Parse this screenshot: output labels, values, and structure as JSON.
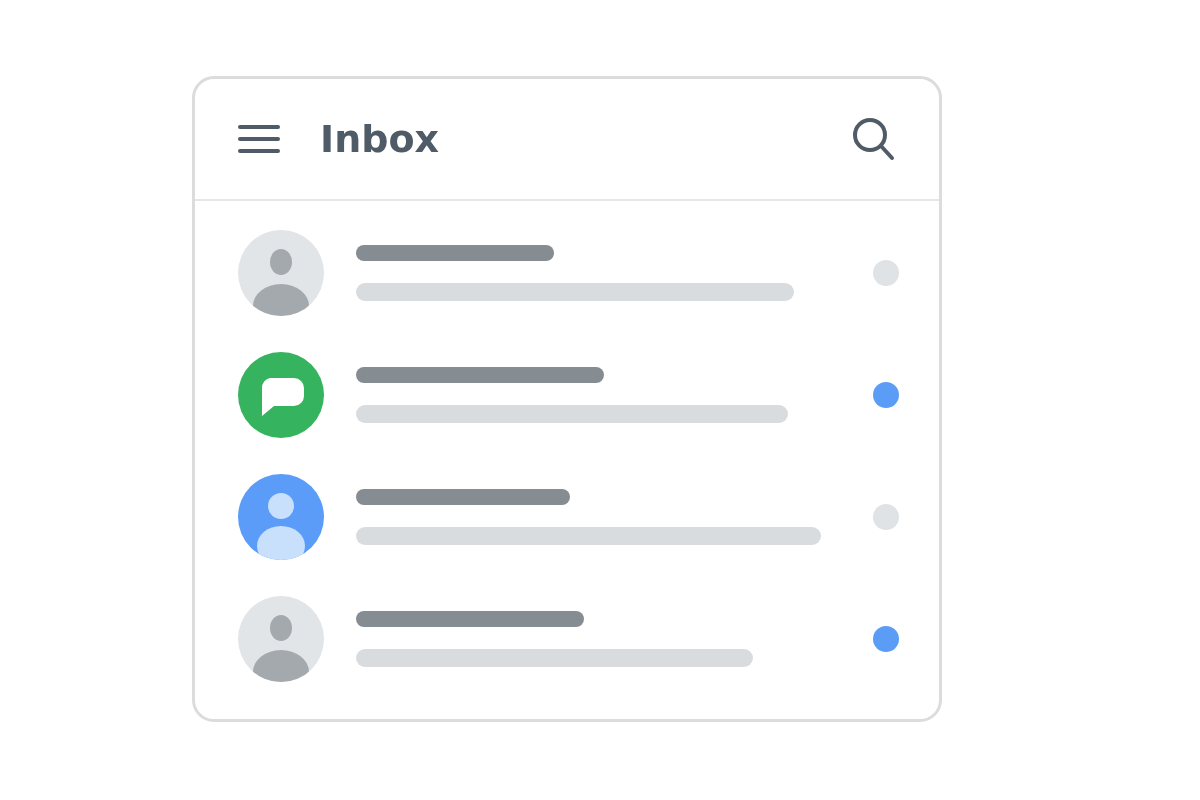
{
  "header": {
    "title": "Inbox"
  },
  "messages": [
    {
      "kind": "person",
      "unread": false
    },
    {
      "kind": "chat",
      "unread": true
    },
    {
      "kind": "accent",
      "unread": false
    },
    {
      "kind": "person",
      "unread": true
    }
  ]
}
